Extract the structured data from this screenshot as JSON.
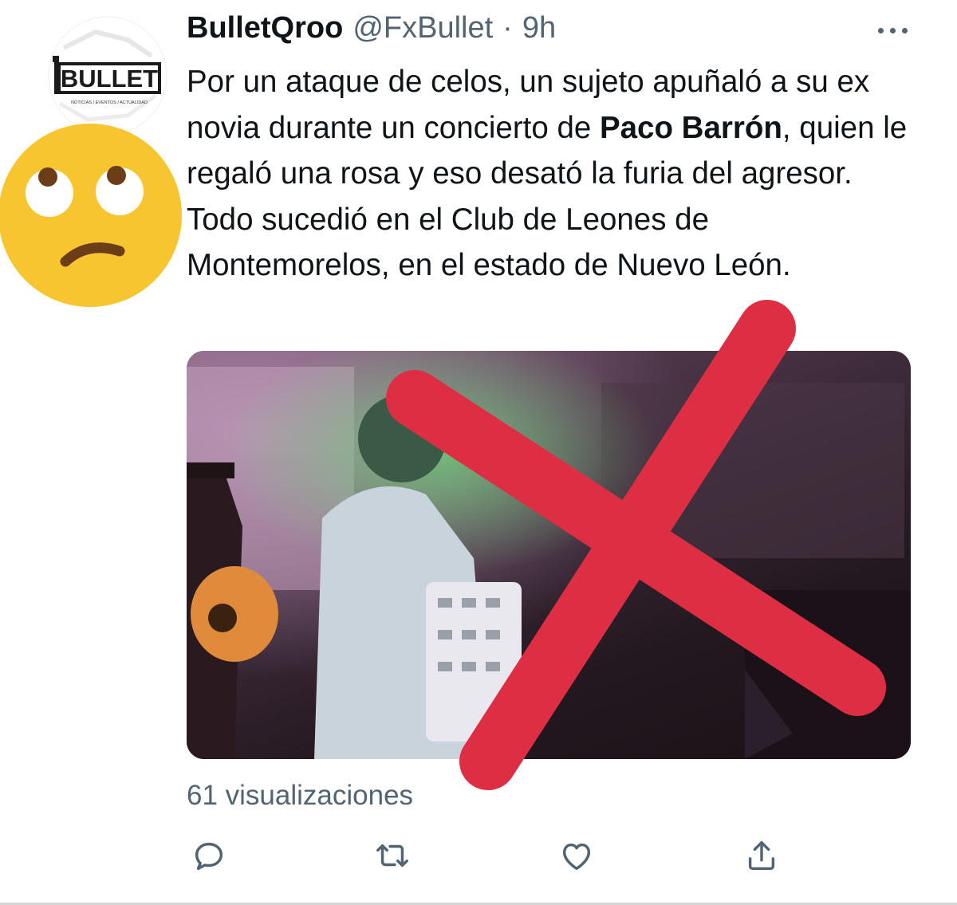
{
  "author": {
    "display_name": "BulletQroo",
    "handle": "@FxBullet",
    "separator": "·",
    "time": "9h",
    "avatar_logo_text": "BULLET",
    "avatar_tagline": "NOTICIAS / EVENTOS / ACTUALIDAD"
  },
  "tweet": {
    "text_part1": "Por un ataque de celos, un sujeto apuñaló a su ex novia durante un concierto de ",
    "text_bold1": "Paco Barrón",
    "text_part2": ", quien le regaló una rosa y eso desató la furia del agresor. Todo sucedió en el Club de Leones de Montemorelos, en el estado de Nuevo León."
  },
  "overlays": {
    "emoji_icon": "face-with-rolling-eyes-emoji",
    "cross_color": "#dd2e44"
  },
  "stats": {
    "views_label": "61 visualizaciones"
  },
  "actions": [
    {
      "icon": "reply-icon"
    },
    {
      "icon": "retweet-icon"
    },
    {
      "icon": "like-icon"
    },
    {
      "icon": "share-icon"
    }
  ],
  "colors": {
    "text_primary": "#0f1419",
    "text_secondary": "#536471"
  }
}
